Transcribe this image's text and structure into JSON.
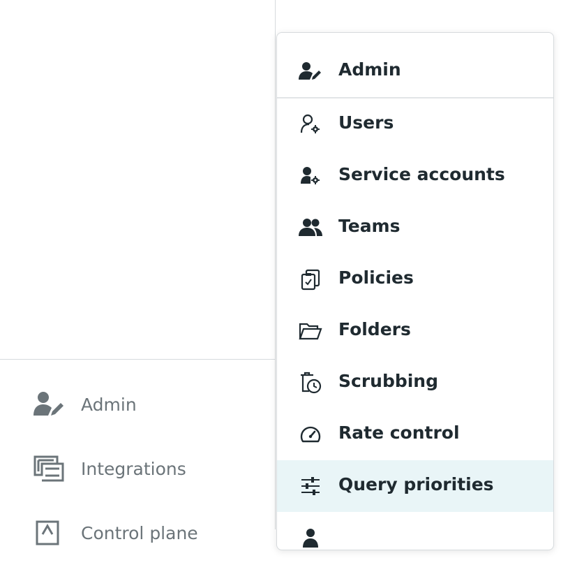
{
  "sidebar": {
    "items": [
      {
        "label": "Admin",
        "icon": "user-edit-icon"
      },
      {
        "label": "Integrations",
        "icon": "integrations-icon"
      },
      {
        "label": "Control plane",
        "icon": "control-plane-icon"
      }
    ]
  },
  "menu": {
    "header": {
      "label": "Admin",
      "icon": "user-edit-icon"
    },
    "items": [
      {
        "label": "Users",
        "icon": "user-gear-outline-icon"
      },
      {
        "label": "Service accounts",
        "icon": "user-gear-icon"
      },
      {
        "label": "Teams",
        "icon": "users-icon"
      },
      {
        "label": "Policies",
        "icon": "clipboard-check-icon"
      },
      {
        "label": "Folders",
        "icon": "folder-open-icon"
      },
      {
        "label": "Scrubbing",
        "icon": "trash-clock-icon"
      },
      {
        "label": "Rate control",
        "icon": "gauge-icon"
      },
      {
        "label": "Query priorities",
        "icon": "sliders-icon"
      },
      {
        "label": "",
        "icon": "user-icon"
      }
    ],
    "active_item": "Query priorities"
  },
  "colors": {
    "active_bg": "#e9f5f7",
    "text_dark": "#1f2a30",
    "text_muted": "#6b7479",
    "divider": "#d6dadd"
  }
}
